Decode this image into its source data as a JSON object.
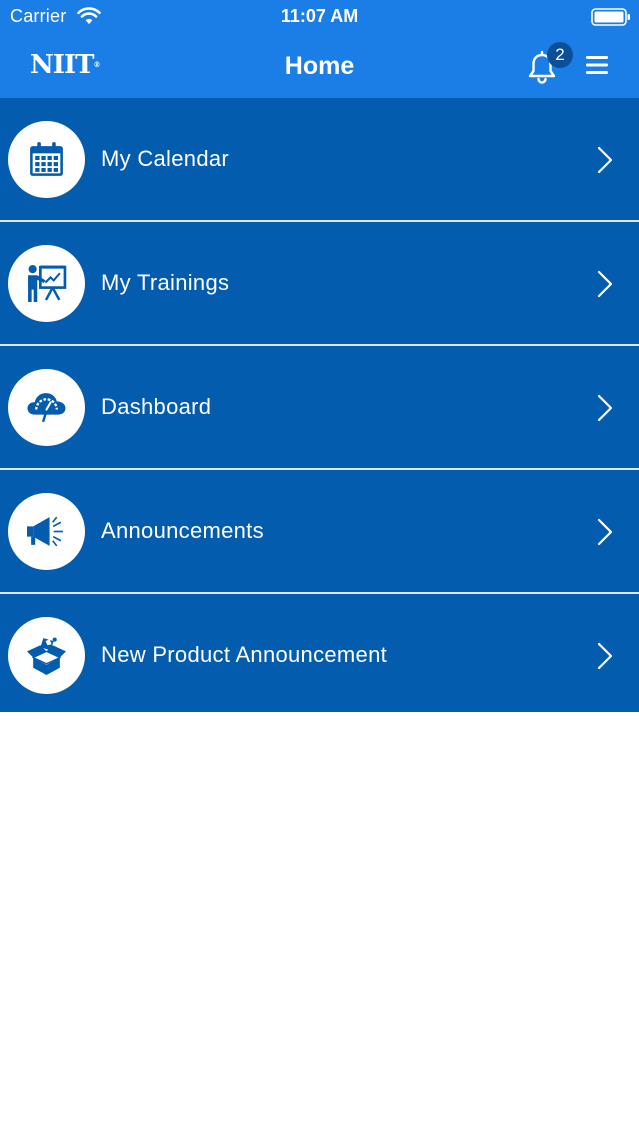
{
  "status_bar": {
    "carrier": "Carrier",
    "time": "11:07 AM"
  },
  "nav": {
    "logo": "NIIT",
    "logo_mark": "®",
    "title": "Home",
    "notification_count": "2"
  },
  "menu": {
    "items": [
      {
        "label": "My Calendar",
        "icon": "calendar-icon"
      },
      {
        "label": "My Trainings",
        "icon": "presentation-icon"
      },
      {
        "label": "Dashboard",
        "icon": "cloud-gauge-icon"
      },
      {
        "label": "Announcements",
        "icon": "megaphone-icon"
      },
      {
        "label": "New Product Announcement",
        "icon": "open-box-icon"
      }
    ]
  },
  "colors": {
    "header_blue": "#1a7ee6",
    "row_blue": "#045cae",
    "badge_blue": "#0b4f99"
  }
}
